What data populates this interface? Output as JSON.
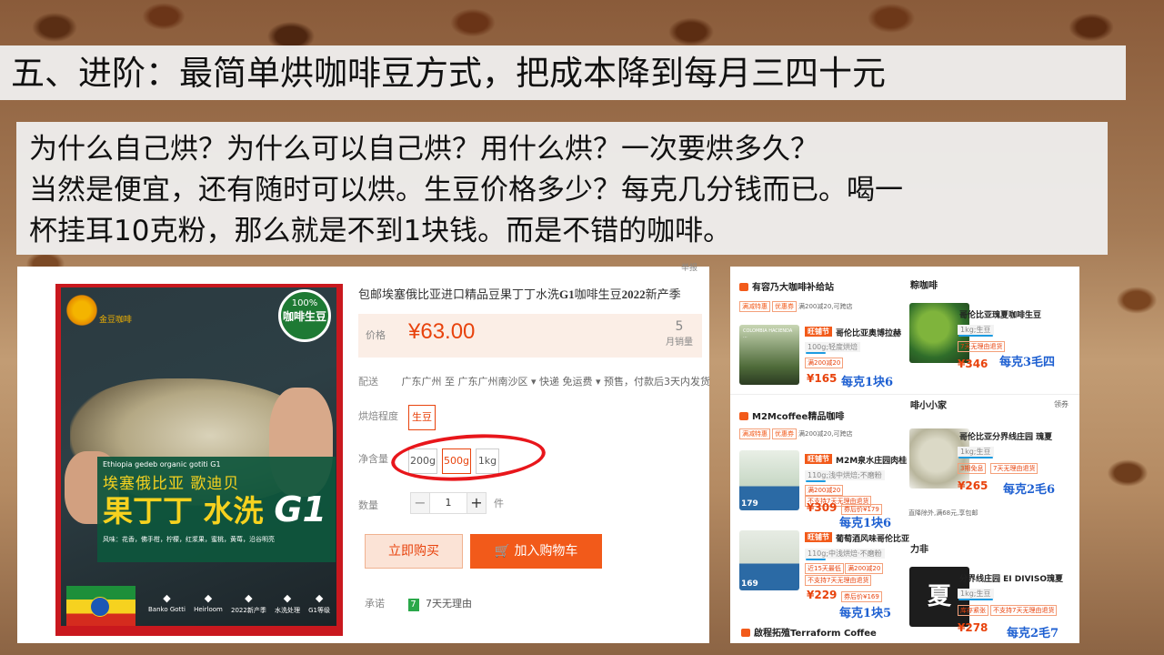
{
  "slide": {
    "title": "五、进阶：最简单烘咖啡豆方式，把成本降到每月三四十元",
    "intro_lines": [
      "为什么自己烘？为什么可以自己烘？用什么烘？一次要烘多久？",
      "当然是便宜，还有随时可以烘。生豆价格多少？每克几分钱而已。喝一",
      "杯挂耳10克粉，那么就是不到1块钱。而是不错的咖啡。"
    ]
  },
  "product": {
    "corner_text": "举报",
    "title_prefix": "包邮埃塞俄比亚进口精品豆果丁丁水洗",
    "title_g1": "G1",
    "title_mid": "咖啡生豆",
    "title_year": "2022",
    "title_suffix": "新产季",
    "price_label": "价格",
    "price": "¥63.00",
    "sold_count": "5",
    "sold_label": "月销量",
    "ship_label": "配送",
    "ship_value": "广东广州 至  广东广州南沙区 ▾   快递 免运费 ▾   预售，付款后3天内发货",
    "roast_label": "烘焙程度",
    "roast_option": "生豆",
    "weight_label": "净含量",
    "weight_options": [
      "200g",
      "500g",
      "1kg"
    ],
    "qty_label": "数量",
    "qty_value": "1",
    "qty_unit": "件",
    "buy_now": "立即购买",
    "add_cart": "加入购物车",
    "promise_label": "承诺",
    "promise_icon": "7",
    "promise_text": "7天无理由",
    "image": {
      "brand": "金豆咖啡",
      "seal_top": "100%",
      "seal_main": "咖啡生豆",
      "en": "Ethiopia gedeb organic gotiti G1",
      "cn1": "埃塞俄比亚  歌迪贝",
      "cn2": "果丁丁 水洗",
      "g1": "G1",
      "flavor": "风味：花香，佛手柑，柠檬，红浆果，蜜桃，黄莓，沿谷明亮",
      "features": [
        "Banko Gotti",
        "Heirloom",
        "2022新产季",
        "水洗处理",
        "G1等级"
      ]
    }
  },
  "listing": {
    "header_right": "粽咖啡",
    "shop1": "有容乃大咖啡补给站",
    "shop1_sub_tags": [
      "满减特惠",
      "优惠券"
    ],
    "shop1_sub": "满200减20,可跨店",
    "item1": {
      "tag": "旺铺节",
      "name": "哥伦比亚奥博拉赫",
      "spec": "100g;轻度烘焙",
      "chip": "满200减20",
      "price": "¥165",
      "note": "每克1块6",
      "thumb_text": "COLOMBIA HACIENDA ..."
    },
    "item_r1": {
      "name": "哥伦比亚瑰夏咖啡生豆",
      "spec": "1kg;生豆",
      "chip": "7天无理由退货",
      "price": "¥346",
      "note": "每克3毛四"
    },
    "shop2": "M2Mcoffee精品咖啡",
    "shop2_sub_tags": [
      "满减特惠",
      "优惠券"
    ],
    "shop2_sub": "满200减20,可跨店",
    "header_right2": "啡小小家",
    "header_right2_link": "领券",
    "item2": {
      "tag": "旺铺节",
      "name": "M2M泉水庄园肉桂",
      "spec": "110g;浅中烘焙;不磨粉",
      "chips": [
        "满200减20",
        "不支持7天无理由退货"
      ],
      "price": "¥309",
      "discount": "券后价¥179",
      "note": "每克1块6",
      "badge": "179"
    },
    "item_r2": {
      "name": "哥伦比亚分界线庄园 瑰夏",
      "spec": "1kg;生豆",
      "chips": [
        "3期免息",
        "7天无理由退货"
      ],
      "price": "¥265",
      "note": "每克2毛6"
    },
    "shipping_note": "直降除外,满68元,享包邮",
    "item3": {
      "tag": "旺铺节",
      "name": "葡萄酒风味哥伦比亚",
      "spec": "110g;中浅烘焙·不磨粉",
      "chips": [
        "近15天最低",
        "满200减20",
        "不支持7天无理由退货"
      ],
      "price": "¥229",
      "discount": "券后价¥169",
      "note": "每克1块5",
      "badge": "169"
    },
    "header_right3": "力非",
    "item_r3": {
      "name": "分界线庄园 EI DIVISO瑰夏",
      "spec": "1kg;生豆",
      "chips": [
        "库存紧张",
        "不支持7天无理由退货"
      ],
      "price": "¥278",
      "note": "每克2毛7",
      "thumb_text": "夏"
    },
    "shop3": "啟程拓殖Terraform Coffee"
  },
  "colors": {
    "accent": "#e8430d",
    "note_blue": "#1d5fd1",
    "circle_red": "#e8161b"
  }
}
